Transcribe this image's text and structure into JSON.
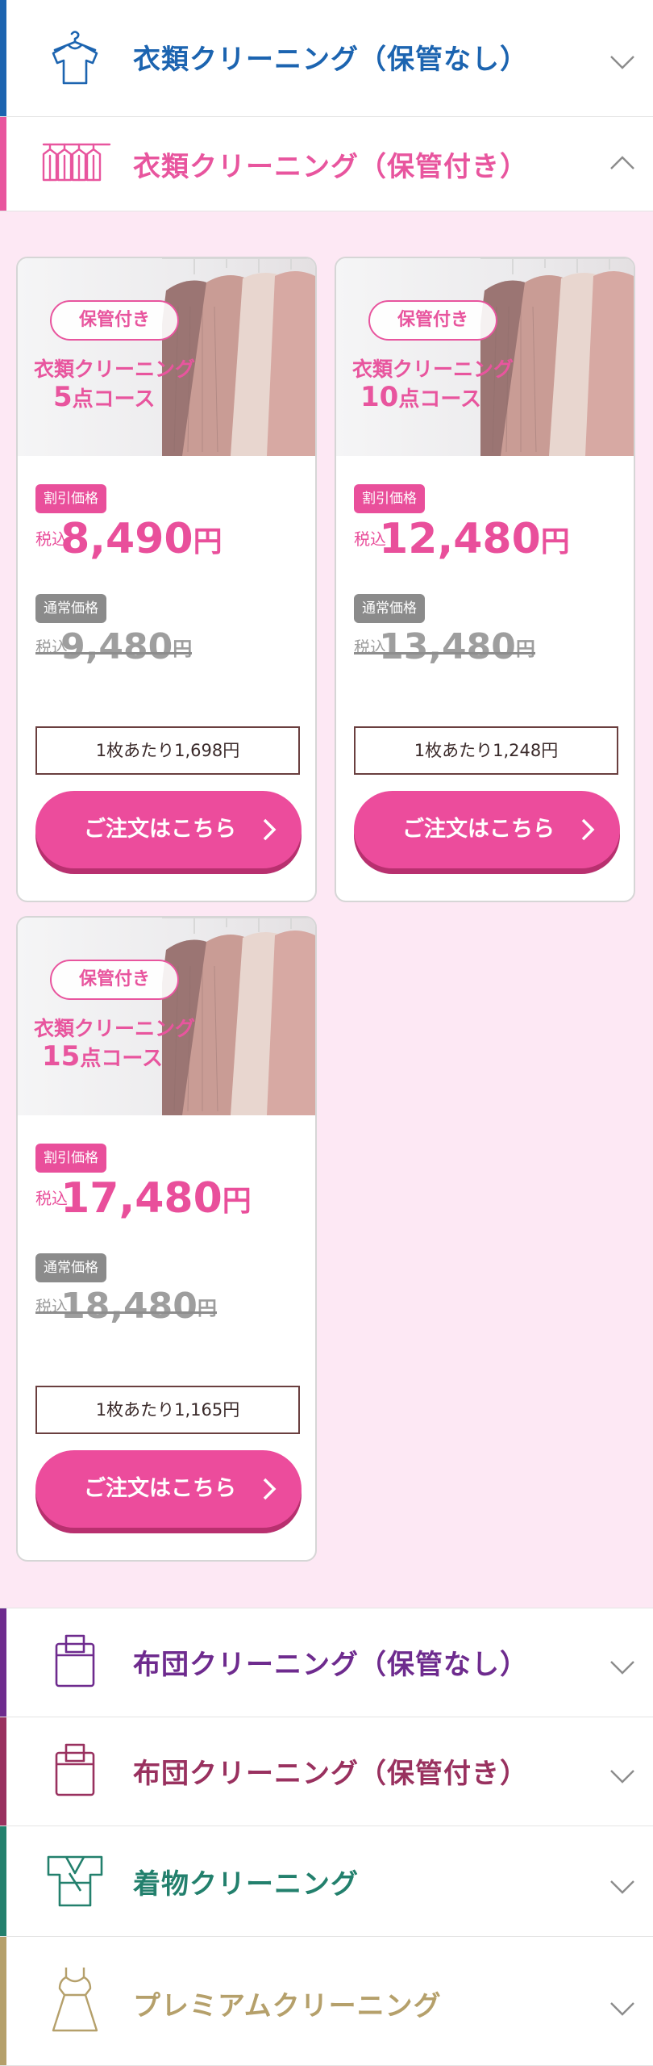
{
  "accordions": [
    {
      "title": "衣類クリーニング（保管なし）",
      "color": "#1c64b0",
      "icon": "shirt-hanger-icon",
      "expanded": false
    },
    {
      "title": "衣類クリーニング（保管付き）",
      "color": "#e8559e",
      "icon": "clothes-rack-icon",
      "expanded": true
    },
    {
      "title": "布団クリーニング（保管なし）",
      "color": "#6e2b8e",
      "icon": "futon-icon",
      "expanded": false
    },
    {
      "title": "布団クリーニング（保管付き）",
      "color": "#99315f",
      "icon": "futon-icon",
      "expanded": false
    },
    {
      "title": "着物クリーニング",
      "color": "#23806d",
      "icon": "kimono-icon",
      "expanded": false
    },
    {
      "title": "プレミアムクリーニング",
      "color": "#b5a06b",
      "icon": "dress-icon",
      "expanded": false
    }
  ],
  "cards": [
    {
      "pill": "保管付き",
      "line1": "衣類クリーニング",
      "count": "5",
      "course": "点コース",
      "discount_label": "割引価格",
      "tax_label": "税込",
      "discount_price": "8,490",
      "regular_label": "通常価格",
      "regular_price": "9,480",
      "yen": "円",
      "per_piece": "1枚あたり1,698円",
      "order_label": "ご注文はこちら"
    },
    {
      "pill": "保管付き",
      "line1": "衣類クリーニング",
      "count": "10",
      "course": "点コース",
      "discount_label": "割引価格",
      "tax_label": "税込",
      "discount_price": "12,480",
      "regular_label": "通常価格",
      "regular_price": "13,480",
      "yen": "円",
      "per_piece": "1枚あたり1,248円",
      "order_label": "ご注文はこちら"
    },
    {
      "pill": "保管付き",
      "line1": "衣類クリーニング",
      "count": "15",
      "course": "点コース",
      "discount_label": "割引価格",
      "tax_label": "税込",
      "discount_price": "17,480",
      "regular_label": "通常価格",
      "regular_price": "18,480",
      "yen": "円",
      "per_piece": "1枚あたり1,165円",
      "order_label": "ご注文はこちら"
    }
  ],
  "colors": {
    "pink": "#e94f9b",
    "pink_bg": "#fde8f4",
    "gray": "#8b8b8b"
  }
}
